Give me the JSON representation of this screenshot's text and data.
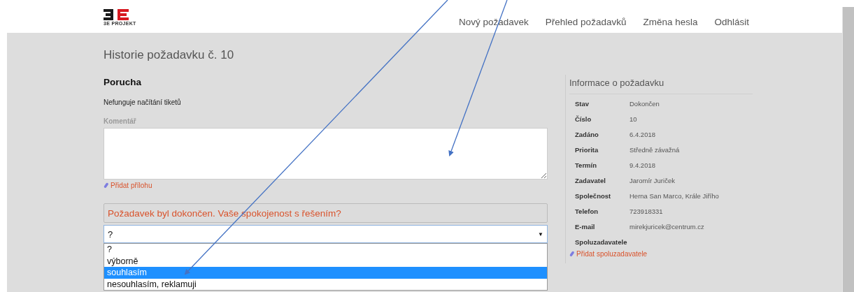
{
  "header": {
    "logo_text": "3E PROJEKT",
    "nav": [
      "Nový požadavek",
      "Přehled požadavků",
      "Změna hesla",
      "Odhlásit"
    ]
  },
  "page_title": "Historie požadavku č. 10",
  "request": {
    "title": "Porucha",
    "description": "Nefunguje načítání tiketů",
    "comment": {
      "label": "Komentář"
    },
    "attach_link": "Přidat přílohu"
  },
  "satisfaction": {
    "question": "Požadavek byl dokončen. Vaše spokojenost s řešením?",
    "value": "?",
    "caret": "▼",
    "expanded": true,
    "options": [
      {
        "label": "?",
        "highlighted": false
      },
      {
        "label": "výborně",
        "highlighted": false
      },
      {
        "label": "souhlasím",
        "highlighted": true
      },
      {
        "label": "nesouhlasím, reklamuji",
        "highlighted": false
      }
    ]
  },
  "info_panel": {
    "title": "Informace o požadavku",
    "rows": [
      {
        "label": "Stav",
        "value": "Dokončen"
      },
      {
        "label": "Číslo",
        "value": "10"
      },
      {
        "label": "Zadáno",
        "value": "6.4.2018"
      },
      {
        "label": "Priorita",
        "value": "Středně závažná"
      },
      {
        "label": "Termín",
        "value": "9.4.2018"
      },
      {
        "label": "Zadavatel",
        "value": "Jaromír Juriček"
      },
      {
        "label": "Společnost",
        "value": "Herna San Marco, Krále Jiřího"
      },
      {
        "label": "Telefon",
        "value": "723918331"
      },
      {
        "label": "E-mail",
        "value": "mirekjuricek@centrum.cz"
      }
    ],
    "co_requesters_label": "Spoluzadavatele",
    "add_co_requester_link": "Přidat spoluzadavatele"
  }
}
